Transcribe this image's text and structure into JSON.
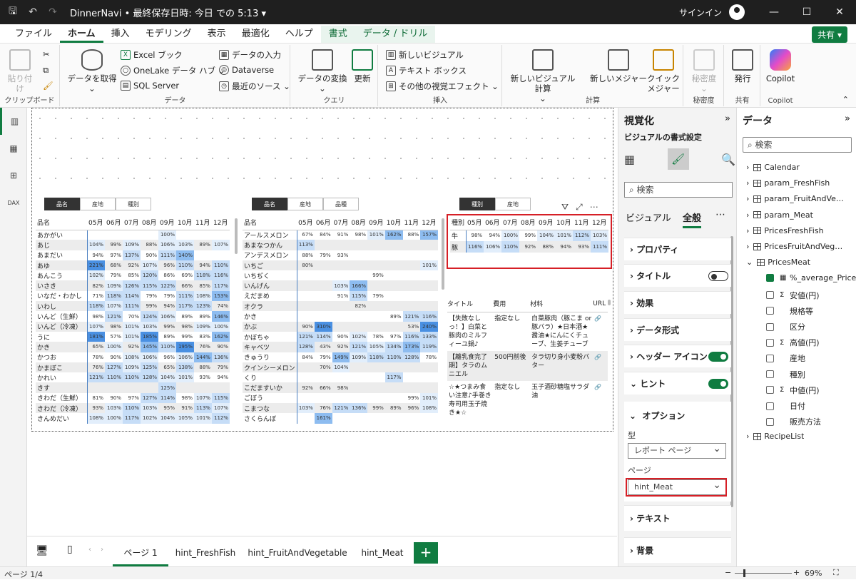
{
  "window": {
    "title": "DinnerNavi • 最終保存日時: 今日 での 5:13 ▾",
    "signin": "サインイン",
    "min": "—",
    "max": "☐",
    "close": "✕"
  },
  "menu": {
    "items": [
      "ファイル",
      "ホーム",
      "挿入",
      "モデリング",
      "表示",
      "最適化",
      "ヘルプ",
      "書式",
      "データ / ドリル"
    ],
    "share": "共有 ▾"
  },
  "ribbon": {
    "clipboard": {
      "paste": "貼り付け",
      "label": "クリップボード"
    },
    "data": {
      "get": "データを取得",
      "excel": "Excel ブック",
      "onelake": "OneLake データ ハブ ⌄",
      "sql": "SQL Server",
      "enter": "データの入力",
      "dataverse": "Dataverse",
      "recent": "最近のソース ⌄",
      "label": "データ"
    },
    "query": {
      "transform": "データの変換",
      "refresh": "更新",
      "label": "クエリ"
    },
    "insert": {
      "newvisual": "新しいビジュアル",
      "textbox": "テキスト ボックス",
      "more": "その他の視覚エフェクト ⌄",
      "label": "挿入"
    },
    "calc": {
      "visualcalc": "新しいビジュアル計算",
      "measure": "新しいメジャー",
      "quick": "クイック",
      "quick2": "メジャー",
      "label": "計算"
    },
    "sens": {
      "name": "秘密度",
      "label": "秘密度"
    },
    "share": {
      "publish": "発行",
      "label": "共有"
    },
    "copilot": {
      "name": "Copilot",
      "label": "Copilot"
    }
  },
  "slicers": {
    "s1": [
      "品名",
      "産地",
      "種別"
    ],
    "s2": [
      "品名",
      "産地",
      "品種"
    ],
    "s3": [
      "種別",
      "産地"
    ]
  },
  "matrix1": {
    "headers": [
      "品名",
      "05月",
      "06月",
      "07月",
      "08月",
      "09月",
      "10月",
      "11月",
      "12月"
    ],
    "rows": [
      [
        "あかがい",
        "",
        "",
        "",
        "",
        "100%",
        "",
        "",
        ""
      ],
      [
        "あじ",
        "104%",
        "99%",
        "109%",
        "88%",
        "106%",
        "103%",
        "89%",
        "107%"
      ],
      [
        "あまだい",
        "94%",
        "97%",
        "137%",
        "90%",
        "111%",
        "140%",
        "",
        ""
      ],
      [
        "あゆ",
        "221%",
        "68%",
        "92%",
        "107%",
        "96%",
        "110%",
        "94%",
        "110%"
      ],
      [
        "あんこう",
        "102%",
        "79%",
        "85%",
        "120%",
        "86%",
        "69%",
        "118%",
        "116%"
      ],
      [
        "いさき",
        "82%",
        "109%",
        "126%",
        "115%",
        "122%",
        "66%",
        "85%",
        "117%"
      ],
      [
        "いなだ・わかし",
        "71%",
        "118%",
        "114%",
        "79%",
        "79%",
        "111%",
        "108%",
        "153%"
      ],
      [
        "いわし",
        "118%",
        "107%",
        "111%",
        "99%",
        "94%",
        "117%",
        "123%",
        "74%"
      ],
      [
        "いんど（生鮮）",
        "98%",
        "121%",
        "70%",
        "124%",
        "106%",
        "89%",
        "89%",
        "146%"
      ],
      [
        "いんど（冷凍）",
        "107%",
        "98%",
        "101%",
        "103%",
        "99%",
        "98%",
        "109%",
        "100%"
      ],
      [
        "うに",
        "181%",
        "57%",
        "101%",
        "185%",
        "89%",
        "99%",
        "83%",
        "162%"
      ],
      [
        "かき",
        "65%",
        "100%",
        "92%",
        "145%",
        "110%",
        "195%",
        "76%",
        "90%"
      ],
      [
        "かつお",
        "78%",
        "90%",
        "108%",
        "106%",
        "96%",
        "106%",
        "144%",
        "136%"
      ],
      [
        "かまぼこ",
        "76%",
        "127%",
        "109%",
        "125%",
        "65%",
        "138%",
        "88%",
        "79%"
      ],
      [
        "かれい",
        "121%",
        "110%",
        "110%",
        "128%",
        "104%",
        "101%",
        "93%",
        "94%"
      ],
      [
        "きす",
        "",
        "",
        "",
        "",
        "125%",
        "",
        "",
        ""
      ],
      [
        "きわだ（生鮮）",
        "81%",
        "90%",
        "97%",
        "127%",
        "114%",
        "98%",
        "107%",
        "115%"
      ],
      [
        "きわだ（冷凍）",
        "93%",
        "103%",
        "110%",
        "103%",
        "95%",
        "91%",
        "113%",
        "107%"
      ],
      [
        "きんめだい",
        "108%",
        "100%",
        "117%",
        "102%",
        "104%",
        "105%",
        "101%",
        "112%"
      ]
    ]
  },
  "matrix2": {
    "headers": [
      "品名",
      "05月",
      "06月",
      "07月",
      "08月",
      "09月",
      "10月",
      "11月",
      "12月"
    ],
    "rows": [
      [
        "アールスメロン",
        "67%",
        "84%",
        "91%",
        "98%",
        "101%",
        "162%",
        "88%",
        "157%"
      ],
      [
        "あまなつかん",
        "113%",
        "",
        "",
        "",
        "",
        "",
        "",
        ""
      ],
      [
        "アンデスメロン",
        "88%",
        "79%",
        "93%",
        "",
        "",
        "",
        "",
        ""
      ],
      [
        "いちご",
        "80%",
        "",
        "",
        "",
        "",
        "",
        "",
        "101%"
      ],
      [
        "いちぢく",
        "",
        "",
        "",
        "",
        "99%",
        "",
        "",
        ""
      ],
      [
        "いんげん",
        "",
        "",
        "103%",
        "166%",
        "",
        "",
        "",
        ""
      ],
      [
        "えだまめ",
        "",
        "",
        "91%",
        "115%",
        "79%",
        "",
        "",
        ""
      ],
      [
        "オクラ",
        "",
        "",
        "",
        "82%",
        "",
        "",
        "",
        ""
      ],
      [
        "かき",
        "",
        "",
        "",
        "",
        "",
        "89%",
        "121%",
        "116%"
      ],
      [
        "かぶ",
        "90%",
        "310%",
        "",
        "",
        "",
        "",
        "53%",
        "240%"
      ],
      [
        "かぼちゃ",
        "121%",
        "114%",
        "90%",
        "102%",
        "78%",
        "97%",
        "116%",
        "133%"
      ],
      [
        "キャベツ",
        "128%",
        "43%",
        "92%",
        "121%",
        "105%",
        "134%",
        "173%",
        "119%"
      ],
      [
        "きゅうり",
        "84%",
        "79%",
        "149%",
        "109%",
        "118%",
        "110%",
        "128%",
        "78%"
      ],
      [
        "クインシーメロン",
        "",
        "70%",
        "104%",
        "",
        "",
        "",
        "",
        ""
      ],
      [
        "くり",
        "",
        "",
        "",
        "",
        "",
        "117%",
        "",
        ""
      ],
      [
        "こだますいか",
        "92%",
        "66%",
        "98%",
        "",
        "",
        "",
        "",
        ""
      ],
      [
        "ごぼう",
        "",
        "",
        "",
        "",
        "",
        "",
        "99%",
        "101%"
      ],
      [
        "こまつな",
        "103%",
        "76%",
        "121%",
        "136%",
        "99%",
        "89%",
        "96%",
        "108%"
      ],
      [
        "さくらんぼ",
        "",
        "161%",
        "",
        "",
        "",
        "",
        "",
        ""
      ]
    ]
  },
  "matrix3": {
    "headers": [
      "種別",
      "05月",
      "06月",
      "07月",
      "08月",
      "09月",
      "10月",
      "11月",
      "12月"
    ],
    "rows": [
      [
        "牛",
        "98%",
        "94%",
        "100%",
        "99%",
        "104%",
        "101%",
        "112%",
        "103%"
      ],
      [
        "豚",
        "116%",
        "106%",
        "110%",
        "92%",
        "88%",
        "94%",
        "93%",
        "111%"
      ]
    ]
  },
  "recipe": {
    "headers": [
      "タイトル",
      "費用",
      "材料",
      "URL"
    ],
    "rows": [
      [
        "【失敗なしっ！】白菜と豚肉のミルフィーユ鍋♪",
        "指定なし",
        "白菜豚肉（豚こま or豚バラ）★日本酒★醤油★にんにくチューブ、生姜チューブ",
        "🔗"
      ],
      [
        "【離乳食完了期】タラのムニエル",
        "500円前後",
        "タラ切り身小麦粉バター",
        "🔗"
      ],
      [
        "☆★つまみ食い注意♪手巻き寿司用玉子焼き★☆",
        "指定なし",
        "玉子酒砂糖塩サラダ油",
        "🔗"
      ]
    ]
  },
  "viz": {
    "title": "視覚化",
    "subtitle": "ビジュアルの書式設定",
    "search": "検索",
    "tab_visual": "ビジュアル",
    "tab_general": "全般",
    "more": "⋯",
    "sections": {
      "properties": "プロパティ",
      "title": "タイトル",
      "effects": "効果",
      "format": "データ形式",
      "header": "ヘッダー アイコン",
      "hint": "ヒント",
      "options": "オプション",
      "text": "テキスト",
      "background": "背景"
    },
    "type_label": "型",
    "type_value": "レポート ページ",
    "page_label": "ページ",
    "page_value": "hint_Meat"
  },
  "data_pane": {
    "title": "データ",
    "search": "検索",
    "items": [
      {
        "label": "Calendar",
        "level": 0
      },
      {
        "label": "param_FreshFish",
        "level": 0
      },
      {
        "label": "param_FruitAndVegetable",
        "level": 0
      },
      {
        "label": "param_Meat",
        "level": 0
      },
      {
        "label": "PricesFreshFish",
        "level": 0
      },
      {
        "label": "PricesFruitAndVegetable",
        "level": 0
      },
      {
        "label": "PricesMeat",
        "level": 0
      },
      {
        "label": "%_average_Price",
        "level": 1,
        "checked": true
      },
      {
        "label": "安値(円)",
        "level": 1,
        "sigma": true
      },
      {
        "label": "規格等",
        "level": 1
      },
      {
        "label": "区分",
        "level": 1
      },
      {
        "label": "高値(円)",
        "level": 1,
        "sigma": true
      },
      {
        "label": "産地",
        "level": 1
      },
      {
        "label": "種別",
        "level": 1
      },
      {
        "label": "中値(円)",
        "level": 1,
        "sigma": true
      },
      {
        "label": "日付",
        "level": 1
      },
      {
        "label": "販売方法",
        "level": 1
      },
      {
        "label": "RecipeList",
        "level": 0
      }
    ]
  },
  "tabs": [
    "ページ 1",
    "hint_FreshFish",
    "hint_FruitAndVegetable",
    "hint_Meat"
  ],
  "status": {
    "page": "ページ 1/4",
    "zoom": "69%"
  },
  "colors": {
    "accent": "#107c41",
    "highlight": "#d61f26"
  }
}
